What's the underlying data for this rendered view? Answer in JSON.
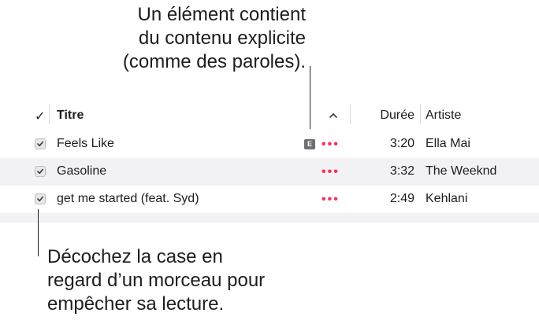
{
  "callouts": {
    "explicit_note": "Un élément contient\ndu contenu explicite\n(comme des paroles).",
    "uncheck_note": "Décochez la case en\nregard d’un morceau pour\nempêcher sa lecture."
  },
  "table": {
    "headers": {
      "check": "✓",
      "title": "Titre",
      "duration": "Durée",
      "artist": "Artiste"
    },
    "rows": [
      {
        "checked": true,
        "title": "Feels Like",
        "explicit": "E",
        "more": "•••",
        "duration": "3:20",
        "artist": "Ella Mai"
      },
      {
        "checked": true,
        "title": "Gasoline",
        "explicit": "",
        "more": "•••",
        "duration": "3:32",
        "artist": "The Weeknd"
      },
      {
        "checked": true,
        "title": "get me started (feat. Syd)",
        "explicit": "",
        "more": "•••",
        "duration": "2:49",
        "artist": "Kehlani"
      }
    ]
  },
  "colors": {
    "accent_more": "#ff2d55",
    "row_alt_bg": "#f2f2f4",
    "explicit_badge": "#6e6e73"
  },
  "icons": {
    "sort": "chevron-up-icon",
    "checkbox": "checkmark-icon",
    "explicit": "explicit-badge-icon",
    "more": "ellipsis-icon"
  }
}
